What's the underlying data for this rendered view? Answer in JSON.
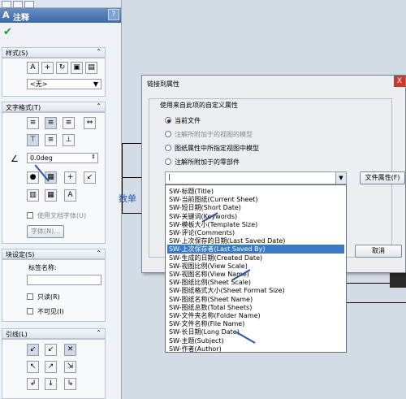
{
  "left_panel": {
    "title": "注释",
    "help_label": "?",
    "style_section": {
      "header": "样式(S)",
      "dropdown_value": "<无>"
    },
    "text_format_section": {
      "header": "文字格式(T)",
      "angle_value": "0.0deg",
      "use_doc_font_label": "使用文档字体(U)",
      "font_button_label": "字体(N)..."
    },
    "block_section": {
      "header": "块设定(S)",
      "label_name": "标签名称:",
      "read_only_label": "只读(R)",
      "invisible_label": "不可见(I)"
    },
    "leader_section": {
      "header": "引线(L)"
    }
  },
  "canvas": {
    "fragment_text": "数单"
  },
  "dialog": {
    "title": "链接到属性",
    "close_label": "X",
    "group_label": "使用来自此项的自定义属性",
    "radios": [
      {
        "label": "当前文件",
        "selected": true,
        "enabled": true
      },
      {
        "label": "注解所附加于的视图的模型",
        "selected": false,
        "enabled": false
      },
      {
        "label": "图纸属性中所指定视图中模型",
        "selected": false,
        "enabled": true
      },
      {
        "label": "注解所附加于的零部件",
        "selected": false,
        "enabled": true
      }
    ],
    "combo_value": "|",
    "file_props_button": "文件属性(F)",
    "cancel_button": "取消"
  },
  "property_list": [
    "SW-标题(Title)",
    "SW-当前图纸(Current Sheet)",
    "SW-短日期(Short Date)",
    "SW-关键词(Keywords)",
    "SW-模板大小(Template Size)",
    "SW-评论(Comments)",
    "SW-上次保存的日期(Last Saved Date)",
    "SW-上次保存者(Last Saved By)",
    "SW-生成的日期(Created Date)",
    "SW-视图比例(View Scale)",
    "SW-视图名称(View Name)",
    "SW-图纸比例(Sheet Scale)",
    "SW-图纸格式大小(Sheet Format Size)",
    "SW-图纸名称(Sheet Name)",
    "SW-图纸总数(Total Sheets)",
    "SW-文件夹名称(Folder Name)",
    "SW-文件名称(File Name)",
    "SW-长日期(Long Date)",
    "SW-主题(Subject)",
    "SW-作者(Author)"
  ],
  "highlighted_index": 7,
  "colors": {
    "accent": "#3a78c9",
    "arrow": "#2a56a8",
    "ok_check": "#1f9a2a",
    "close": "#c93a2a"
  }
}
